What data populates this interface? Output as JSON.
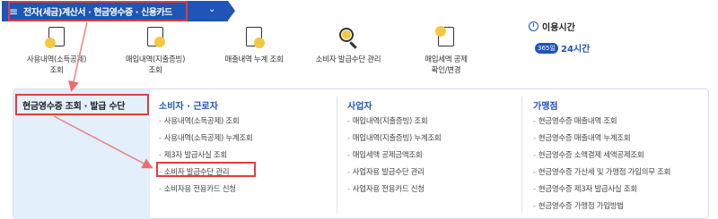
{
  "nav": {
    "title": "전자(세금)계산서 · 현금영수증 · 신용카드",
    "menu_icon": "hamburger-icon",
    "dropdown_icon": "chevron-down-icon"
  },
  "icon_menu": [
    {
      "label_line1": "사용내역(소득공제)",
      "label_line2": "조회",
      "icon": "user-doc-icon"
    },
    {
      "label_line1": "매입내역(지출증빙)",
      "label_line2": "조회",
      "icon": "receipt-icon"
    },
    {
      "label_line1": "매출내역 누계 조회",
      "label_line2": "",
      "icon": "sales-doc-icon"
    },
    {
      "label_line1": "소비자 발급수단 관리",
      "label_line2": "",
      "icon": "magnifier-icon"
    },
    {
      "label_line1": "매입세액 공제",
      "label_line2": "확인/변경",
      "icon": "tax-check-icon"
    }
  ],
  "hours": {
    "label": "이용시간",
    "badge": "365일",
    "value": "24시간",
    "icon": "clock-icon"
  },
  "panel": {
    "left_title": "현금영수증 조회 · 발급 수단",
    "columns": [
      {
        "heading": "소비자 · 근로자",
        "items": [
          "사용내역(소득공제) 조회",
          "사용내역(소득공제) 누계조회",
          "제3자 발급사실 조회",
          "소비자 발급수단 관리",
          "소비자용 전용카드 신청"
        ]
      },
      {
        "heading": "사업자",
        "items": [
          "매입내역(지출증빙) 조회",
          "매입내역(지출증빙) 누계조회",
          "매입세액 공제금액조회",
          "사업자용 발급수단 관리",
          "사업자용 전용카드 신청"
        ]
      },
      {
        "heading": "가맹점",
        "items": [
          "현금영수증 매출내역 조회",
          "현금영수증 매출내역 누계조회",
          "현금영수증 소액결제 세액공제조회",
          "현금영수증 가산세 및 가맹점 가입의무 조회",
          "현금영수증 제3자 발급사실 조회",
          "현금영수증 가맹점 가입방법"
        ]
      }
    ]
  },
  "colors": {
    "primary": "#1f55b6",
    "highlight": "#e23d3d",
    "panel_left_bg": "#e3effb"
  }
}
